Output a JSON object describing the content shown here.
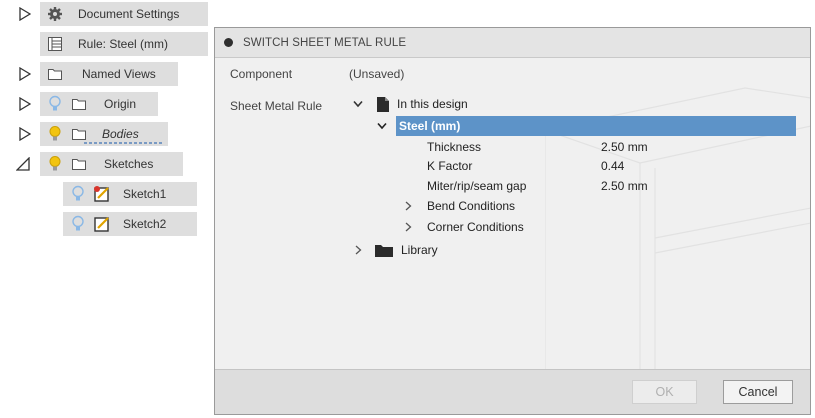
{
  "browser": {
    "document_settings": "Document Settings",
    "rule": "Rule: Steel (mm)",
    "named_views": "Named Views",
    "origin": "Origin",
    "bodies": "Bodies",
    "sketches": "Sketches",
    "sketch1": "Sketch1",
    "sketch2": "Sketch2"
  },
  "dialog": {
    "title": "SWITCH SHEET METAL RULE",
    "component_label": "Component",
    "component_value": "(Unsaved)",
    "rule_label": "Sheet Metal Rule",
    "tree": {
      "in_this_design": "In this design",
      "steel": "Steel (mm)",
      "thickness_label": "Thickness",
      "thickness_value": "2.50 mm",
      "kfactor_label": "K Factor",
      "kfactor_value": "0.44",
      "miter_label": "Miter/rip/seam gap",
      "miter_value": "2.50 mm",
      "bend_conditions": "Bend Conditions",
      "corner_conditions": "Corner Conditions",
      "library": "Library"
    },
    "ok_label": "OK",
    "cancel_label": "Cancel"
  },
  "colors": {
    "selection": "#5d93c8",
    "bulb_on": "#f2c40f",
    "bulb_off": "#8ab8e6",
    "pill": "#dedede"
  }
}
